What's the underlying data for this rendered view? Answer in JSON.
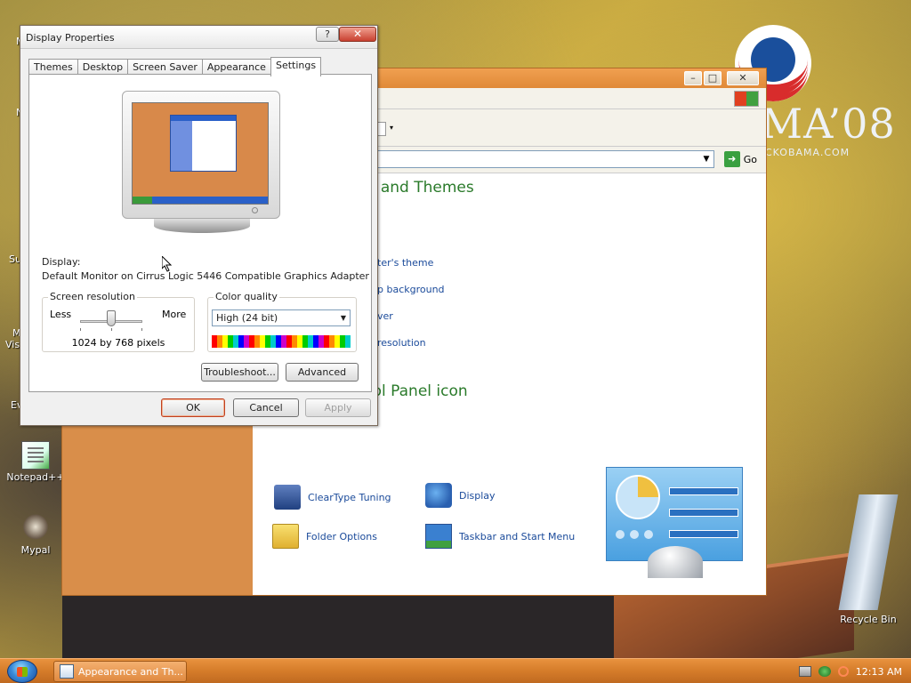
{
  "desktop": {
    "campaign_text": "MA’08",
    "campaign_url": "CKOBAMA.COM",
    "icons": [
      {
        "label": "Notepad++"
      },
      {
        "label": "Mypal"
      },
      {
        "label": "Recycle Bin"
      }
    ],
    "left_edge_labels": [
      "M",
      "C",
      "N",
      "Su",
      "M",
      "Visi",
      "Ev"
    ]
  },
  "control_panel": {
    "title": "",
    "address_go": "Go",
    "heading_category": "e and Themes",
    "tasks": [
      "ter's theme",
      "p background",
      "ver",
      "resolution"
    ],
    "heading_icon": "rol Panel icon",
    "icons": [
      {
        "label": "ClearType Tuning",
        "icon": "cleartype-icon"
      },
      {
        "label": "Display",
        "icon": "display-icon"
      },
      {
        "label": "Folder Options",
        "icon": "folder-icon"
      },
      {
        "label": "Taskbar and Start Menu",
        "icon": "taskbar-icon"
      }
    ],
    "colors": {
      "accent": "#d98e4a",
      "link": "#1a4a9a",
      "heading": "#2a7a2a"
    }
  },
  "dialog": {
    "title": "Display Properties",
    "help_glyph": "?",
    "close_glyph": "✕",
    "tabs": [
      "Themes",
      "Desktop",
      "Screen Saver",
      "Appearance",
      "Settings"
    ],
    "active_tab": "Settings",
    "display_label": "Display:",
    "display_value": "Default Monitor on Cirrus Logic 5446 Compatible Graphics Adapter",
    "resolution": {
      "legend": "Screen resolution",
      "less": "Less",
      "more": "More",
      "value": "1024 by 768 pixels"
    },
    "color_quality": {
      "legend": "Color quality",
      "selected": "High (24 bit)"
    },
    "buttons": {
      "troubleshoot": "Troubleshoot...",
      "advanced": "Advanced",
      "ok": "OK",
      "cancel": "Cancel",
      "apply": "Apply"
    }
  },
  "taskbar": {
    "task_label": "Appearance and Th...",
    "clock": "12:13 AM",
    "colors": {
      "bar": "#d57c2a"
    }
  }
}
